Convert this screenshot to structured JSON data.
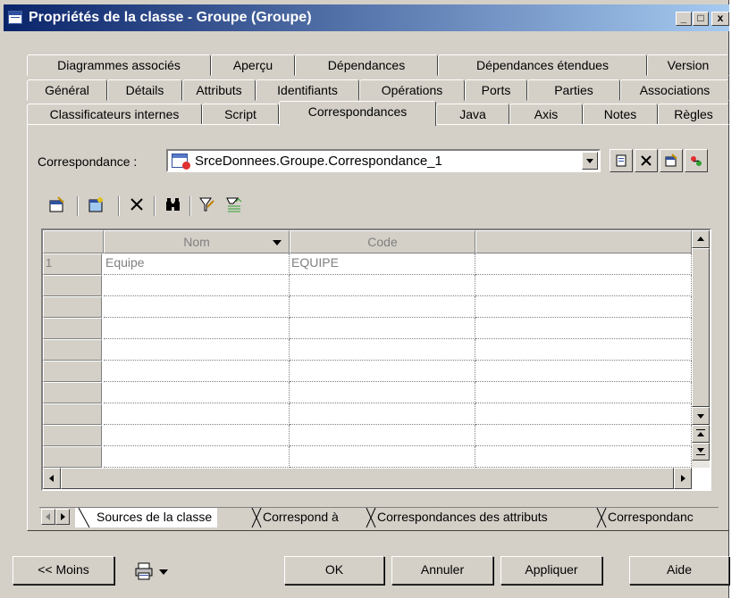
{
  "window": {
    "title": "Propriétés de la classe - Groupe (Groupe)",
    "minimize_label": "_",
    "maximize_label": "□",
    "close_label": "x"
  },
  "tabs": {
    "row1": [
      "Diagrammes associés",
      "Aperçu",
      "Dépendances",
      "Dépendances étendues",
      "Version"
    ],
    "row2": [
      "Général",
      "Détails",
      "Attributs",
      "Identifiants",
      "Opérations",
      "Ports",
      "Parties",
      "Associations"
    ],
    "row3": [
      "Classificateurs internes",
      "Script",
      "Correspondances",
      "Java",
      "Axis",
      "Notes",
      "Règles"
    ],
    "active": "Correspondances"
  },
  "mapping": {
    "label": "Correspondance :",
    "value": "SrceDonnees.Groupe.Correspondance_1"
  },
  "grid": {
    "columns": [
      "Nom",
      "Code"
    ],
    "rows": [
      {
        "num": "1",
        "nom": "Equipe",
        "code": "EQUIPE"
      }
    ],
    "empty_rows": 10
  },
  "sheet_tabs": [
    "Sources de la classe",
    "Correspond à",
    "Correspondances des attributs",
    "Correspondanc"
  ],
  "buttons": {
    "moins": "<< Moins",
    "ok": "OK",
    "annuler": "Annuler",
    "appliquer": "Appliquer",
    "aide": "Aide"
  },
  "icons": {
    "toolbar": [
      "properties-icon",
      "add-objects-icon",
      "delete-icon",
      "find-icon",
      "filter-icon",
      "filter-settings-icon"
    ],
    "combo_side": [
      "new-icon",
      "delete-icon",
      "properties-icon",
      "create-mapping-icon"
    ]
  }
}
